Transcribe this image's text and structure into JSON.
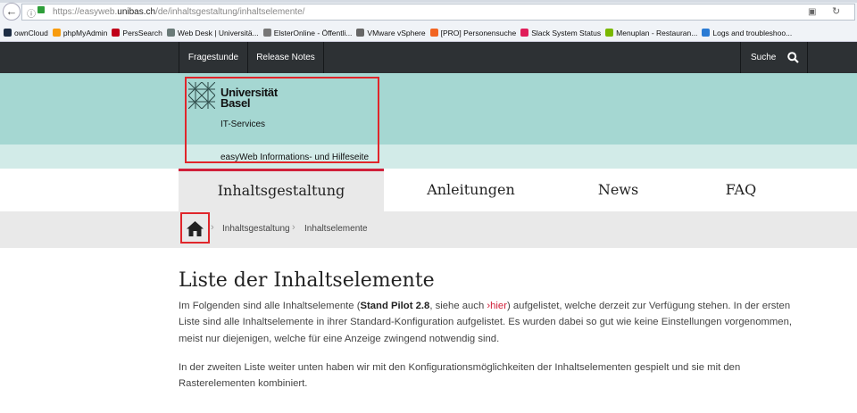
{
  "browser": {
    "url_prefix": "https://easyweb.",
    "url_domain": "unibas.ch",
    "url_path": "/de/inhaltsgestaltung/inhaltselemente/",
    "bookmarks": [
      {
        "label": "ownCloud",
        "icon": "owncloud-icon",
        "color": "#1d2d44"
      },
      {
        "label": "phpMyAdmin",
        "icon": "phpmyadmin-icon",
        "color": "#f89c0e"
      },
      {
        "label": "PersSearch",
        "icon": "phone-icon",
        "color": "#c0001a"
      },
      {
        "label": "Web Desk | Universitä...",
        "icon": "unibas-icon",
        "color": "#6a7a78"
      },
      {
        "label": "ElsterOnline - Öffentli...",
        "icon": "elster-icon",
        "color": "#777777"
      },
      {
        "label": "VMware vSphere",
        "icon": "globe-icon",
        "color": "#666666"
      },
      {
        "label": "[PRO] Personensuche",
        "icon": "pro-arrow-icon",
        "color": "#f26522"
      },
      {
        "label": "Slack System Status",
        "icon": "slack-icon",
        "color": "#e01e5a"
      },
      {
        "label": "Menuplan - Restauran...",
        "icon": "sv-icon",
        "color": "#7ab800"
      },
      {
        "label": "Logs and troubleshoo...",
        "icon": "logs-icon",
        "color": "#2a7bd4"
      }
    ]
  },
  "topnav": {
    "items": [
      "Fragestunde",
      "Release Notes"
    ],
    "search": "Suche"
  },
  "header": {
    "logo_line1": "Universität",
    "logo_line2": "Basel",
    "unit": "IT-Services",
    "subtitle": "easyWeb Informations- und Hilfeseite"
  },
  "mainnav": {
    "items": [
      "Inhaltsgestaltung",
      "Anleitungen",
      "News",
      "FAQ"
    ],
    "active": "Inhaltsgestaltung"
  },
  "breadcrumb": [
    "Inhaltsgestaltung",
    "Inhaltselemente"
  ],
  "content": {
    "title": "Liste der Inhaltselemente",
    "p1_a": "Im Folgenden sind alle Inhaltselemente (",
    "p1_bold": "Stand Pilot 2.8",
    "p1_b": ", siehe auch ",
    "p1_link": "hier",
    "p1_c": ") aufgelistet, welche derzeit zur Verfügung stehen. In der ersten Liste sind alle Inhaltselemente in ihrer Standard-Konfiguration aufgelistet. Es wurden dabei so gut wie keine Einstellungen vorgenommen, meist nur diejenigen, welche für eine Anzeige zwingend notwendig sind.",
    "p2": "In der zweiten Liste weiter unten haben wir mit den Konfigurationsmöglichkeiten der Inhaltselementen gespielt und sie mit den Rasterelementen kombiniert."
  },
  "colors": {
    "accent": "#d1203a",
    "header": "#a5d7d2",
    "topnav": "#2d3134"
  }
}
